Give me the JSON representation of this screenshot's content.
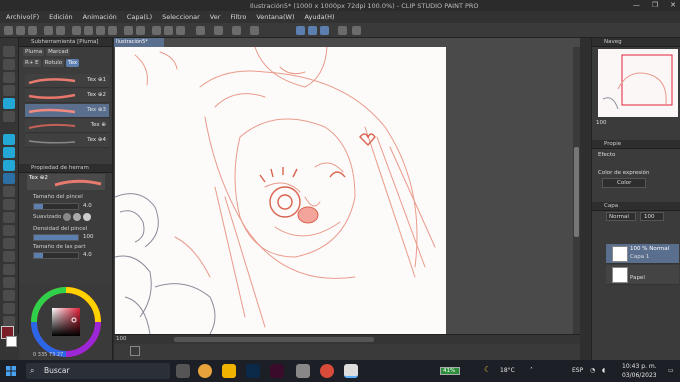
{
  "window": {
    "title": "Ilustración5* (1000 x 1000px 72dpi 100.0%)  - CLIP STUDIO PAINT PRO",
    "controls": [
      "—",
      "❐",
      "✕"
    ]
  },
  "menu": [
    "Archivo(F)",
    "Edición",
    "Animación",
    "Capa(L)",
    "Seleccionar",
    "Ver",
    "Filtro",
    "Ventana(W)",
    "Ayuda(H)"
  ],
  "subtool_panel": {
    "title": "Subherramienta [Pluma]",
    "tabs": [
      "Pluma",
      "Marcad",
      "R+ E",
      "Rotulo",
      "Tex"
    ],
    "brushes": [
      "Tex ⊕1",
      "Tex ⊕2",
      "Tex ⊕3",
      "Tex ⊕",
      "Tex ⊕4"
    ]
  },
  "property_panel": {
    "title": "Propiedad de herram",
    "preset_label": "Tex ⊕2",
    "brush_size_label": "Tamaño del pincel",
    "brush_size_value": "4.0",
    "smoothing_label": "Suavizado",
    "density_label": "Densidad del pincel",
    "density_value": "100",
    "density_fraction": 1.0,
    "pressure_label": "Tamaño de las part",
    "pressure_value": "4.0"
  },
  "color_panel": {
    "main_color": "#7a1f2a",
    "sub_color": "#ffffff",
    "readout": "0  335  73  27",
    "selected_color": "#c8203a"
  },
  "canvas_tab": {
    "label": "Ilustración5*"
  },
  "statusbar": {
    "zoom": "100"
  },
  "navigator": {
    "title": "Naveg",
    "zoom": "100"
  },
  "layer_props": {
    "title": "Propie",
    "effect_label": "Efecto",
    "expression_label": "Color de expresión",
    "expression_value": "Color"
  },
  "layers_panel": {
    "title": "Capa",
    "blend": "Normal",
    "opacity": "100",
    "layers": [
      {
        "line1": "100 % Normal",
        "line2": "Capa 1",
        "selected": true
      },
      {
        "line1": "",
        "line2": "Papel",
        "selected": false
      }
    ]
  },
  "taskbar": {
    "search_placeholder": "Buscar",
    "battery": "41%",
    "temperature": "18°C",
    "language": "ESP",
    "time": "10:43 p. m.",
    "date": "03/06/2023"
  }
}
